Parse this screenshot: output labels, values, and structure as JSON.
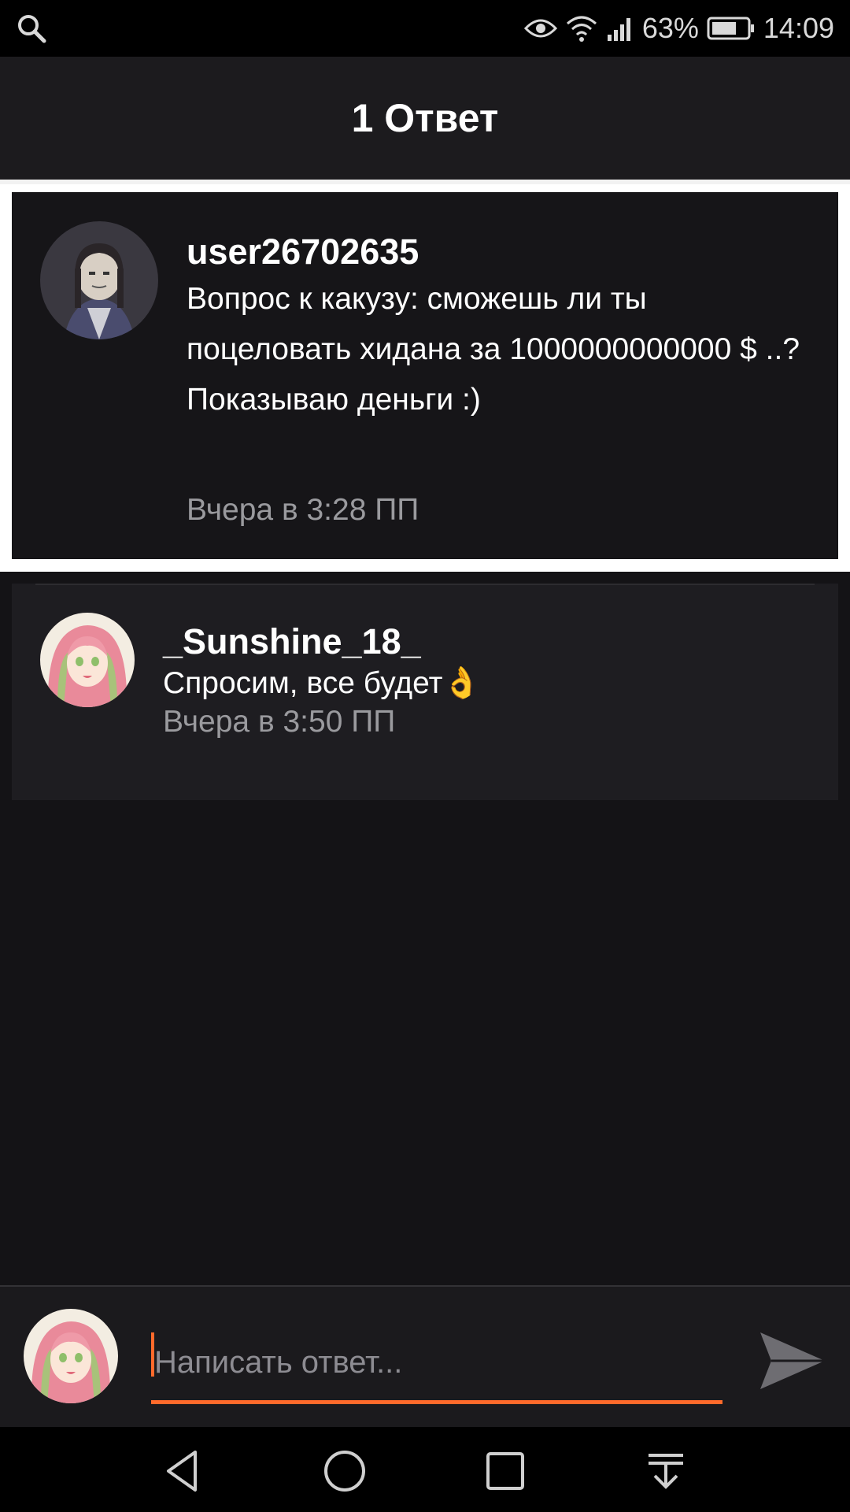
{
  "status_bar": {
    "battery": "63%",
    "time": "14:09"
  },
  "header": {
    "title": "1 Ответ"
  },
  "parent_comment": {
    "username": "user26702635",
    "text": "Вопрос к какузу: сможешь ли ты поцеловать хидана за 1000000000000 $ ..?\nПоказываю деньги :)",
    "time": "Вчера в 3:28 ПП"
  },
  "reply": {
    "username": "_Sunshine_18_",
    "text": "Спросим, все будет👌",
    "time": "Вчера в 3:50 ПП"
  },
  "composer": {
    "placeholder": "Написать ответ..."
  },
  "colors": {
    "accent": "#ff6a2b",
    "background": "#141316",
    "header": "#1c1b1e"
  }
}
